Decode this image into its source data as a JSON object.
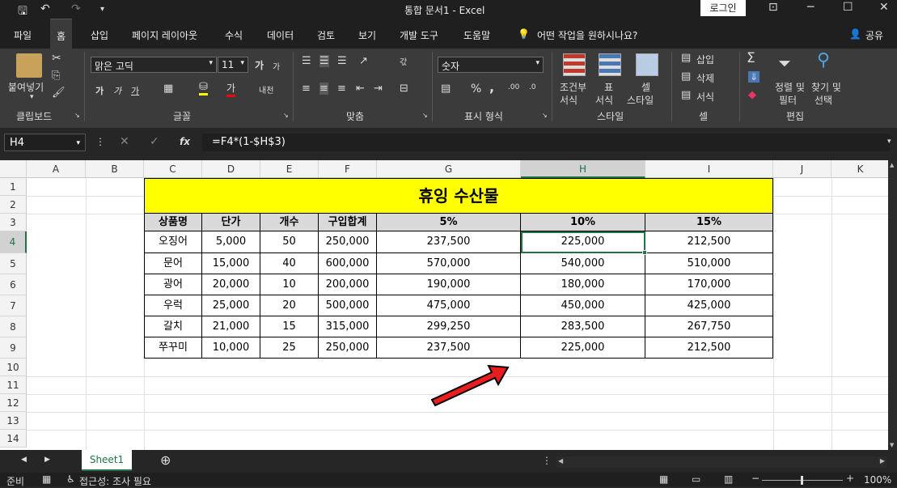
{
  "window": {
    "title": "통합 문서1  -  Excel",
    "login_label": "로그인"
  },
  "tabs": [
    "파일",
    "홈",
    "삽입",
    "페이지 레이아웃",
    "수식",
    "데이터",
    "검토",
    "보기",
    "개발 도구",
    "도움말"
  ],
  "tell_me": "어떤 작업을 원하시나요?",
  "share_label": "공유",
  "ribbon": {
    "groups": [
      "클립보드",
      "글꼴",
      "맞춤",
      "표시 형식",
      "스타일",
      "셀",
      "편집"
    ],
    "paste_label": "붙여넣기",
    "font_name": "맑은 고딕",
    "font_size": "11",
    "font_grow": "가",
    "font_shrink": "가",
    "bold": "가",
    "italic": "가",
    "underline": "가",
    "font_color_glyph": "가",
    "phonetic": "내천",
    "wrap_glyph": "갃",
    "number_format": "숫자",
    "percent": "%",
    "comma": ",",
    "cond_format_l1": "조건부",
    "cond_format_l2": "서식",
    "table_l1": "표",
    "table_l2": "서식",
    "cell_style_l1": "셀",
    "cell_style_l2": "스타일",
    "insert": "삽입",
    "delete": "삭제",
    "format": "서식",
    "sort_l1": "정렬 및",
    "sort_l2": "필터",
    "find_l1": "찾기 및",
    "find_l2": "선택"
  },
  "formula_bar": {
    "name_box": "H4",
    "formula": "=F4*(1-$H$3)",
    "fx": "fx"
  },
  "columns": [
    "A",
    "B",
    "C",
    "D",
    "E",
    "F",
    "G",
    "H",
    "I",
    "J",
    "K"
  ],
  "rows": [
    "1",
    "2",
    "3",
    "4",
    "5",
    "6",
    "7",
    "8",
    "9",
    "10",
    "11",
    "12",
    "13",
    "14"
  ],
  "sheet": {
    "title": "휴잉 수산물",
    "headers": [
      "상품명",
      "단가",
      "개수",
      "구입합계",
      "5%",
      "10%",
      "15%"
    ],
    "data": [
      [
        "오징어",
        "5,000",
        "50",
        "250,000",
        "237,500",
        "225,000",
        "212,500"
      ],
      [
        "문어",
        "15,000",
        "40",
        "600,000",
        "570,000",
        "540,000",
        "510,000"
      ],
      [
        "광어",
        "20,000",
        "10",
        "200,000",
        "190,000",
        "180,000",
        "170,000"
      ],
      [
        "우럭",
        "25,000",
        "20",
        "500,000",
        "475,000",
        "450,000",
        "425,000"
      ],
      [
        "갈치",
        "21,000",
        "15",
        "315,000",
        "299,250",
        "283,500",
        "267,750"
      ],
      [
        "쭈꾸미",
        "10,000",
        "25",
        "250,000",
        "237,500",
        "225,000",
        "212,500"
      ]
    ]
  },
  "sheet_tab": "Sheet1",
  "status": {
    "ready": "준비",
    "accessibility": "접근성: 조사 필요",
    "zoom": "100%"
  },
  "colors": {
    "accent": "#217346",
    "title_fill": "#ffff00",
    "arrow": "#e81e1e"
  }
}
